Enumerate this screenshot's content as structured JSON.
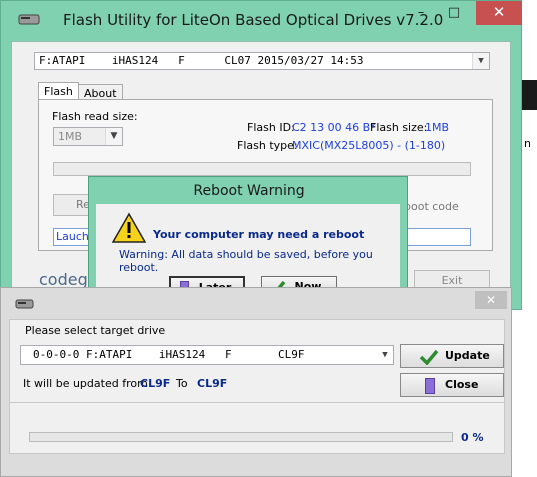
{
  "main_window": {
    "title": "Flash Utility for LiteOn Based Optical Drives v7.2.0",
    "drive_combo": "F:ATAPI    iHAS124   F      CL07 2015/03/27 14:53",
    "tabs": [
      "Flash",
      "About"
    ],
    "flash_read_size_label": "Flash read size:",
    "flash_read_size_value": "1MB",
    "flash_id_label": "Flash ID:",
    "flash_id_value": "C2 13 00 46 B*",
    "flash_size_label": "Flash size:",
    "flash_size_value": "1MB",
    "flash_type_label": "Flash type:",
    "flash_type_value": "MXIC(MX25L8005) - (1-180)",
    "read_button_partial": "Re",
    "boot_code_partial": "boot code",
    "log_partial": "Lauchin",
    "logo_partial": "codeg",
    "exit_label": "Exit"
  },
  "side_text": {
    "fragment": "n"
  },
  "reboot_dialog": {
    "title": "Reboot Warning",
    "heading": "Your computer may need a reboot",
    "message": "Warning: All data should be saved, before you reboot.",
    "later_label": "Later",
    "now_label": "Now"
  },
  "select_window": {
    "prompt": "Please select target drive",
    "drive_value": "0-0-0-0 F:ATAPI    iHAS124   F       CL9F",
    "update_label": "Update",
    "close_label": "Close",
    "updated_from_label": "It will be updated from",
    "from_value": "CL9F",
    "to_label": "To",
    "to_value": "CL9F",
    "progress_text": "0 %",
    "progress": 0
  },
  "colors": {
    "accent": "#7fd1b0",
    "close_red": "#c75050",
    "navy": "#0a2a8a",
    "link_blue": "#1e3fdc",
    "check_green": "#2e8b2e"
  }
}
